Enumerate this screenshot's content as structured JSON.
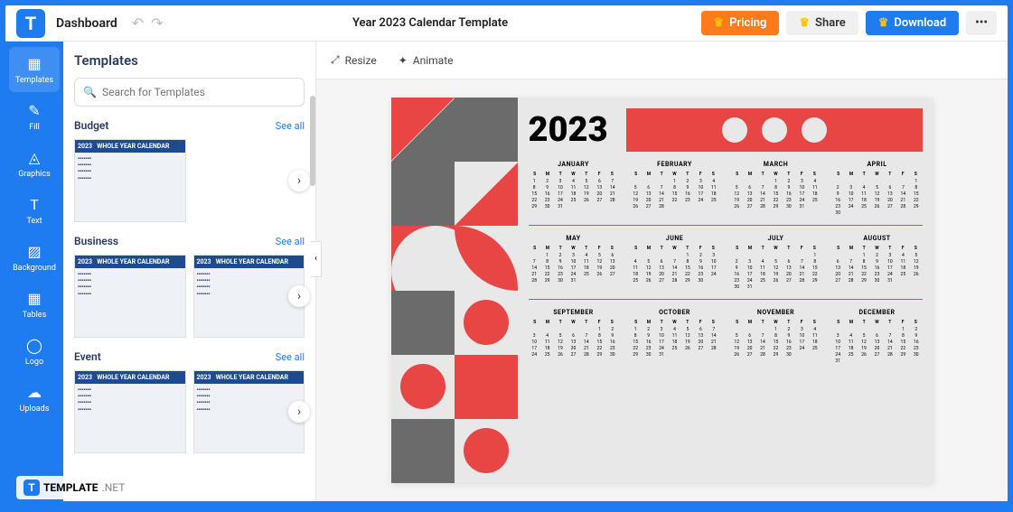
{
  "topbar": {
    "dashboard": "Dashboard",
    "doc_title": "Year 2023 Calendar Template",
    "pricing": "Pricing",
    "share": "Share",
    "download": "Download",
    "more": "•••"
  },
  "rail": [
    {
      "label": "Templates",
      "icon": "▦"
    },
    {
      "label": "Fill",
      "icon": "✎"
    },
    {
      "label": "Graphics",
      "icon": "◬"
    },
    {
      "label": "Text",
      "icon": "T"
    },
    {
      "label": "Background",
      "icon": "▨"
    },
    {
      "label": "Tables",
      "icon": "▦"
    },
    {
      "label": "Logo",
      "icon": "◯"
    },
    {
      "label": "Uploads",
      "icon": "☁"
    }
  ],
  "sidebar": {
    "title": "Templates",
    "search_placeholder": "Search for Templates",
    "categories": [
      {
        "name": "Budget",
        "see_all": "See all"
      },
      {
        "name": "Business",
        "see_all": "See all"
      },
      {
        "name": "Event",
        "see_all": "See all"
      }
    ]
  },
  "toolbar": {
    "resize": "Resize",
    "animate": "Animate"
  },
  "calendar": {
    "year": "2023",
    "dow": [
      "S",
      "M",
      "T",
      "W",
      "T",
      "F",
      "S"
    ],
    "months": [
      {
        "name": "JANUARY",
        "start": 0,
        "days": 31
      },
      {
        "name": "FEBRUARY",
        "start": 3,
        "days": 28
      },
      {
        "name": "MARCH",
        "start": 3,
        "days": 31
      },
      {
        "name": "APRIL",
        "start": 6,
        "days": 30
      },
      {
        "name": "MAY",
        "start": 1,
        "days": 31
      },
      {
        "name": "JUNE",
        "start": 4,
        "days": 30
      },
      {
        "name": "JULY",
        "start": 6,
        "days": 31
      },
      {
        "name": "AUGUST",
        "start": 2,
        "days": 31
      },
      {
        "name": "SEPTEMBER",
        "start": 5,
        "days": 30
      },
      {
        "name": "OCTOBER",
        "start": 0,
        "days": 31
      },
      {
        "name": "NOVEMBER",
        "start": 3,
        "days": 30
      },
      {
        "name": "DECEMBER",
        "start": 5,
        "days": 31
      }
    ]
  },
  "watermark": {
    "brand": "TEMPLATE",
    "suffix": ".NET"
  }
}
